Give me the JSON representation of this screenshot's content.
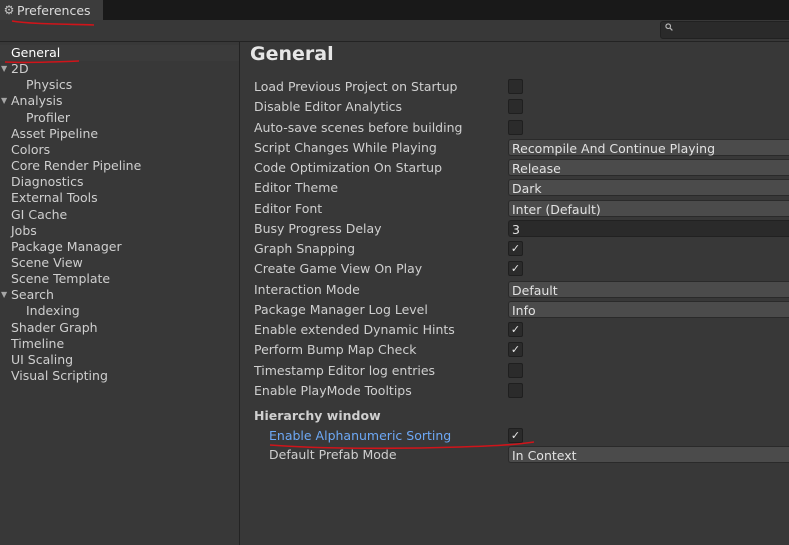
{
  "window": {
    "tab_title": "Preferences",
    "tab_icon": "gear-icon",
    "search_icon": "search-icon",
    "search_value": ""
  },
  "sidebar": {
    "items": [
      {
        "label": "General",
        "selected": true
      },
      {
        "label": "2D",
        "expandable": true
      },
      {
        "label": "Physics",
        "child": true
      },
      {
        "label": "Analysis",
        "expandable": true
      },
      {
        "label": "Profiler",
        "child": true
      },
      {
        "label": "Asset Pipeline"
      },
      {
        "label": "Colors"
      },
      {
        "label": "Core Render Pipeline"
      },
      {
        "label": "Diagnostics"
      },
      {
        "label": "External Tools"
      },
      {
        "label": "GI Cache"
      },
      {
        "label": "Jobs"
      },
      {
        "label": "Package Manager"
      },
      {
        "label": "Scene View"
      },
      {
        "label": "Scene Template"
      },
      {
        "label": "Search",
        "expandable": true
      },
      {
        "label": "Indexing",
        "child": true
      },
      {
        "label": "Shader Graph"
      },
      {
        "label": "Timeline"
      },
      {
        "label": "UI Scaling"
      },
      {
        "label": "Visual Scripting"
      }
    ]
  },
  "main": {
    "title": "General",
    "rows": [
      {
        "label": "Load Previous Project on Startup",
        "control": "checkbox",
        "checked": false
      },
      {
        "label": "Disable Editor Analytics",
        "control": "checkbox",
        "checked": false
      },
      {
        "label": "Auto-save scenes before building",
        "control": "checkbox",
        "checked": false
      },
      {
        "label": "Script Changes While Playing",
        "control": "dropdown",
        "value": "Recompile And Continue Playing"
      },
      {
        "label": "Code Optimization On Startup",
        "control": "dropdown",
        "value": "Release"
      },
      {
        "label": "Editor Theme",
        "control": "dropdown",
        "value": "Dark"
      },
      {
        "label": "Editor Font",
        "control": "dropdown",
        "value": "Inter (Default)"
      },
      {
        "label": "Busy Progress Delay",
        "control": "number",
        "value": "3"
      },
      {
        "label": "Graph Snapping",
        "control": "checkbox",
        "checked": true
      },
      {
        "label": "Create Game View On Play",
        "control": "checkbox",
        "checked": true
      },
      {
        "label": "Interaction Mode",
        "control": "dropdown",
        "value": "Default"
      },
      {
        "label": "Package Manager Log Level",
        "control": "dropdown",
        "value": "Info"
      },
      {
        "label": "Enable extended Dynamic Hints",
        "control": "checkbox",
        "checked": true
      },
      {
        "label": "Perform Bump Map Check",
        "control": "checkbox",
        "checked": true
      },
      {
        "label": "Timestamp Editor log entries",
        "control": "checkbox",
        "checked": false
      },
      {
        "label": "Enable PlayMode Tooltips",
        "control": "checkbox",
        "checked": false
      }
    ],
    "hierarchy_section": {
      "title": "Hierarchy window",
      "rows": [
        {
          "label": "Enable Alphanumeric Sorting",
          "control": "checkbox",
          "checked": true
        },
        {
          "label": "Default Prefab Mode",
          "control": "dropdown",
          "value": "In Context"
        }
      ]
    }
  },
  "colors": {
    "annotation": "#d0141a",
    "highlight_label": "#6da8f5"
  }
}
